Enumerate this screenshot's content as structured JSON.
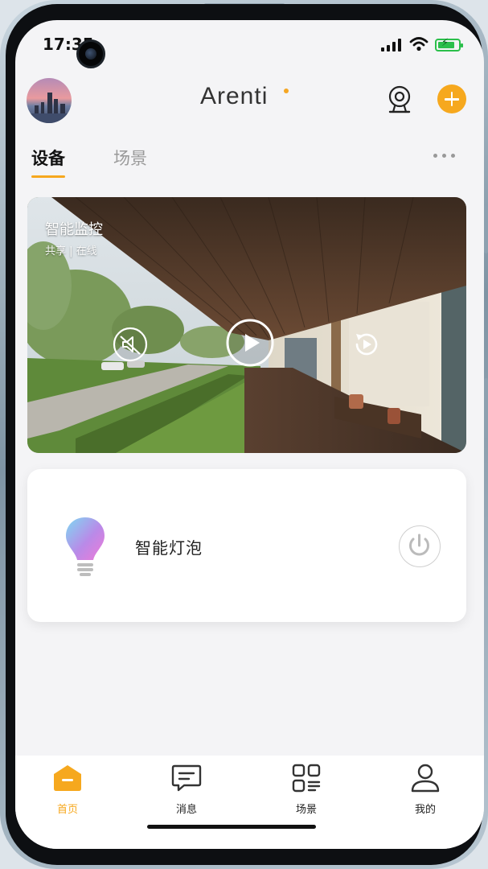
{
  "status_bar": {
    "time": "17:35"
  },
  "header": {
    "logo_text": "Arenti",
    "accent_color": "#f6a81e"
  },
  "tabs": [
    {
      "label": "设备",
      "active": true
    },
    {
      "label": "场景",
      "active": false
    }
  ],
  "camera_card": {
    "title": "智能监控",
    "subtitle": "共享 | 在线"
  },
  "bulb_card": {
    "name": "智能灯泡"
  },
  "bottom_nav": [
    {
      "label": "首页",
      "icon": "home-icon",
      "active": true
    },
    {
      "label": "消息",
      "icon": "message-icon",
      "active": false
    },
    {
      "label": "场景",
      "icon": "scenes-icon",
      "active": false
    },
    {
      "label": "我的",
      "icon": "profile-icon",
      "active": false
    }
  ]
}
